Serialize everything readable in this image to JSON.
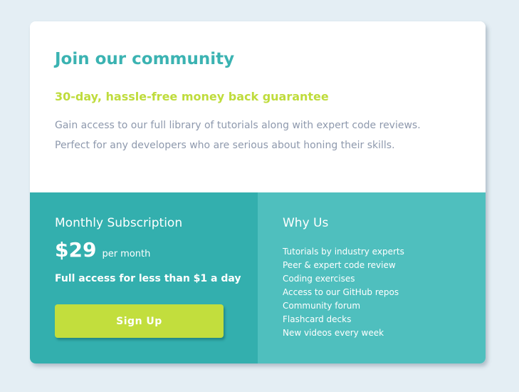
{
  "header": {
    "title": "Join our community",
    "subtitle": "30-day, hassle-free money back guarantee",
    "description_line1": "Gain access to our full library of tutorials along with expert code reviews.",
    "description_line2": "Perfect for any developers who are serious about honing their skills."
  },
  "subscription": {
    "title": "Monthly Subscription",
    "price": "$29",
    "period": "per month",
    "tagline": "Full access for less than $1 a day",
    "button_label": "Sign Up"
  },
  "why_us": {
    "title": "Why Us",
    "items": [
      "Tutorials by industry experts",
      "Peer & expert code review",
      "Coding exercises",
      "Access to our GitHub repos",
      "Community forum",
      "Flashcard decks",
      "New videos every week"
    ]
  },
  "colors": {
    "page_background": "#e4eef4",
    "accent_teal": "#3bb3b2",
    "accent_lime": "#bfdc3c",
    "subscription_panel": "#33afae",
    "why_us_panel": "#4fbfbe",
    "body_text": "#8e99ad"
  }
}
